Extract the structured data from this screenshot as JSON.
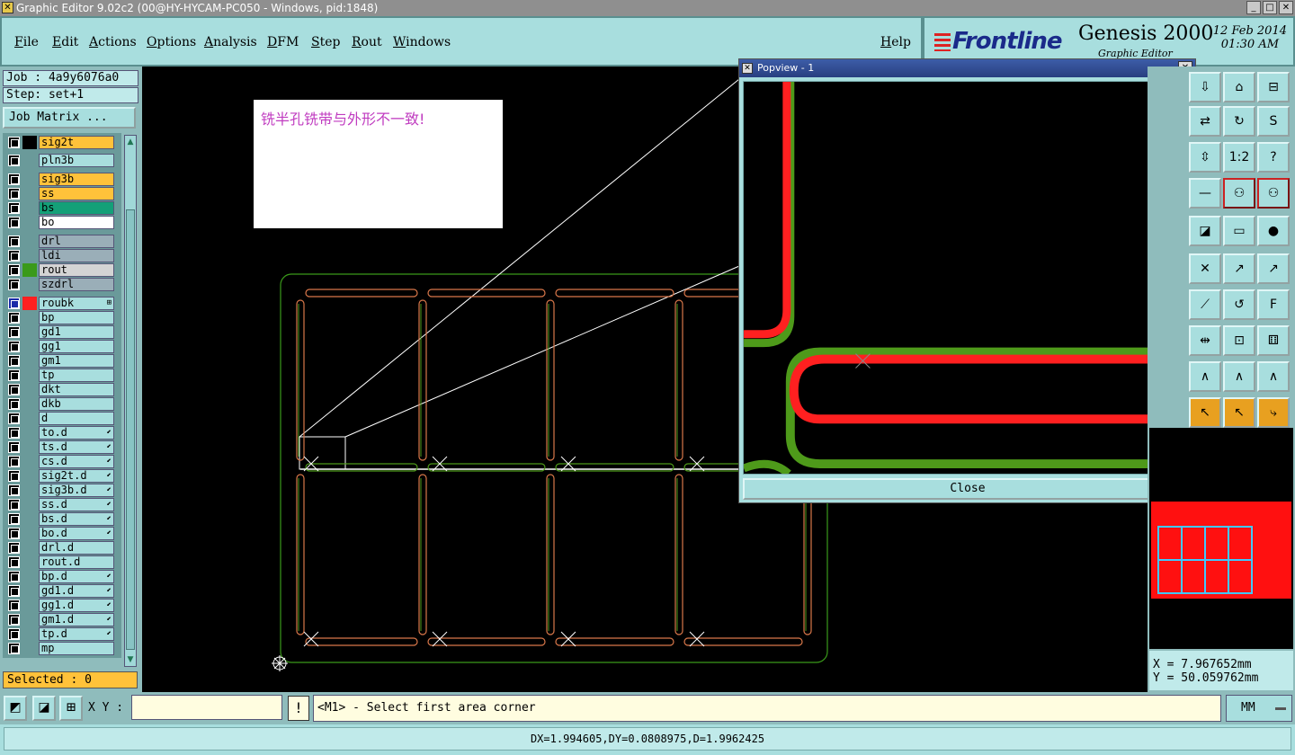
{
  "window": {
    "title": "Graphic Editor 9.02c2 (00@HY-HYCAM-PC050 - Windows, pid:1848)"
  },
  "menu": {
    "items": [
      "File",
      "Edit",
      "Actions",
      "Options",
      "Analysis",
      "DFM",
      "Step",
      "Rout",
      "Windows"
    ],
    "help": "Help"
  },
  "logo": {
    "brand": "Frontline",
    "product": "Genesis 2000",
    "subtitle": "Graphic Editor",
    "date": "12 Feb 2014",
    "time": "01:30 AM"
  },
  "job": {
    "job_label": "Job : 4a9y6076a0",
    "step_label": "Step: set+1",
    "matrix_button": "Job Matrix ..."
  },
  "layers": [
    {
      "name": "sig2t",
      "color": "#ffc23a",
      "swatch": "#000000"
    },
    {
      "name": "pln3b",
      "color": "#a8dede",
      "swatch": ""
    },
    {
      "name": "sig3b",
      "color": "#ffc23a",
      "swatch": ""
    },
    {
      "name": "ss",
      "color": "#ffc23a",
      "swatch": ""
    },
    {
      "name": "bs",
      "color": "#14a078",
      "swatch": ""
    },
    {
      "name": "bo",
      "color": "#ffffff",
      "swatch": ""
    },
    {
      "name": "drl",
      "color": "#9aaeb8",
      "swatch": ""
    },
    {
      "name": "ldi",
      "color": "#9aaeb8",
      "swatch": ""
    },
    {
      "name": "rout",
      "color": "#d4d4d4",
      "swatch": "#3a9a1a"
    },
    {
      "name": "szdrl",
      "color": "#9aaeb8",
      "swatch": ""
    },
    {
      "name": "roubk",
      "color": "#a8dede",
      "swatch": "#ff2020",
      "mark": "⊞"
    },
    {
      "name": "bp",
      "color": "#a8dede",
      "swatch": ""
    },
    {
      "name": "gd1",
      "color": "#a8dede",
      "swatch": ""
    },
    {
      "name": "gg1",
      "color": "#a8dede",
      "swatch": ""
    },
    {
      "name": "gm1",
      "color": "#a8dede",
      "swatch": ""
    },
    {
      "name": "tp",
      "color": "#a8dede",
      "swatch": ""
    },
    {
      "name": "dkt",
      "color": "#a8dede",
      "swatch": ""
    },
    {
      "name": "dkb",
      "color": "#a8dede",
      "swatch": ""
    },
    {
      "name": "d",
      "color": "#a8dede",
      "swatch": ""
    },
    {
      "name": "to.d",
      "color": "#a8dede",
      "swatch": "",
      "mark": "⬋"
    },
    {
      "name": "ts.d",
      "color": "#a8dede",
      "swatch": "",
      "mark": "⬋"
    },
    {
      "name": "cs.d",
      "color": "#a8dede",
      "swatch": "",
      "mark": "⬋"
    },
    {
      "name": "sig2t.d",
      "color": "#a8dede",
      "swatch": "",
      "mark": "⬋"
    },
    {
      "name": "sig3b.d",
      "color": "#a8dede",
      "swatch": "",
      "mark": "⬋"
    },
    {
      "name": "ss.d",
      "color": "#a8dede",
      "swatch": "",
      "mark": "⬋"
    },
    {
      "name": "bs.d",
      "color": "#a8dede",
      "swatch": "",
      "mark": "⬋"
    },
    {
      "name": "bo.d",
      "color": "#a8dede",
      "swatch": "",
      "mark": "⬋"
    },
    {
      "name": "drl.d",
      "color": "#a8dede",
      "swatch": ""
    },
    {
      "name": "rout.d",
      "color": "#a8dede",
      "swatch": ""
    },
    {
      "name": "bp.d",
      "color": "#a8dede",
      "swatch": "",
      "mark": "⬋"
    },
    {
      "name": "gd1.d",
      "color": "#a8dede",
      "swatch": "",
      "mark": "⬋"
    },
    {
      "name": "gg1.d",
      "color": "#a8dede",
      "swatch": "",
      "mark": "⬋"
    },
    {
      "name": "gm1.d",
      "color": "#a8dede",
      "swatch": "",
      "mark": "⬋"
    },
    {
      "name": "tp.d",
      "color": "#a8dede",
      "swatch": "",
      "mark": "⬋"
    },
    {
      "name": "mp",
      "color": "#a8dede",
      "swatch": ""
    }
  ],
  "selection": {
    "label": "Selected : 0"
  },
  "note": {
    "text": "铣半孔铣带与外形不一致!"
  },
  "popview": {
    "title": "Popview - 1",
    "close_label": "Close"
  },
  "bottom": {
    "xy_label": "X Y :",
    "xy_value": "",
    "prompt": "<M1> - Select first area corner",
    "units": "MM",
    "measure": "DX=1.994605,DY=0.0808975,D=1.9962425"
  },
  "coords": {
    "x": "X  = 7.967652mm",
    "y": "Y  = 50.059762mm"
  },
  "colors": {
    "panel": "#a8dede",
    "rout_green": "#4e9a1a",
    "roubk_red": "#ff2020",
    "profile_green": "#3a9a1a",
    "accent_orange": "#ffc23a"
  }
}
